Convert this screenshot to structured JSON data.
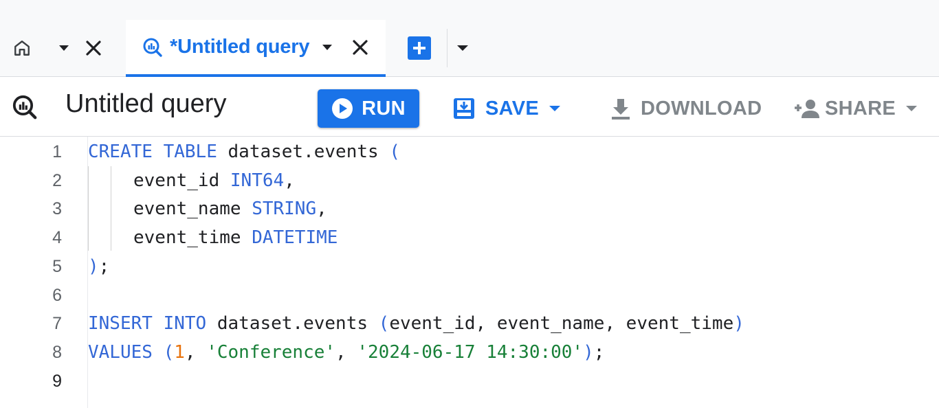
{
  "tabs": {
    "home": {
      "icon": "home-icon"
    },
    "query": {
      "label": "*Untitled query",
      "icon": "query-icon"
    }
  },
  "toolbar": {
    "title": "Untitled query",
    "run_label": "RUN",
    "save_label": "SAVE",
    "download_label": "DOWNLOAD",
    "share_label": "SHARE"
  },
  "editor": {
    "lines": [
      {
        "number": "1",
        "tokens": [
          {
            "t": "kw",
            "v": "CREATE"
          },
          {
            "t": "punc",
            "v": " "
          },
          {
            "t": "kw",
            "v": "TABLE"
          },
          {
            "t": "punc",
            "v": " dataset.events "
          },
          {
            "t": "paren",
            "v": "("
          }
        ]
      },
      {
        "number": "2",
        "indent": true,
        "tokens": [
          {
            "t": "punc",
            "v": "event_id "
          },
          {
            "t": "kw",
            "v": "INT64"
          },
          {
            "t": "punc",
            "v": ","
          }
        ]
      },
      {
        "number": "3",
        "indent": true,
        "tokens": [
          {
            "t": "punc",
            "v": "event_name "
          },
          {
            "t": "kw",
            "v": "STRING"
          },
          {
            "t": "punc",
            "v": ","
          }
        ]
      },
      {
        "number": "4",
        "indent": true,
        "tokens": [
          {
            "t": "punc",
            "v": "event_time "
          },
          {
            "t": "kw",
            "v": "DATETIME"
          }
        ]
      },
      {
        "number": "5",
        "tokens": [
          {
            "t": "paren",
            "v": ")"
          },
          {
            "t": "punc",
            "v": ";"
          }
        ]
      },
      {
        "number": "6",
        "tokens": []
      },
      {
        "number": "7",
        "tokens": [
          {
            "t": "kw",
            "v": "INSERT"
          },
          {
            "t": "punc",
            "v": " "
          },
          {
            "t": "kw",
            "v": "INTO"
          },
          {
            "t": "punc",
            "v": " dataset.events "
          },
          {
            "t": "paren",
            "v": "("
          },
          {
            "t": "punc",
            "v": "event_id, event_name, event_time"
          },
          {
            "t": "paren",
            "v": ")"
          }
        ]
      },
      {
        "number": "8",
        "tokens": [
          {
            "t": "kw",
            "v": "VALUES"
          },
          {
            "t": "punc",
            "v": " "
          },
          {
            "t": "paren",
            "v": "("
          },
          {
            "t": "num",
            "v": "1"
          },
          {
            "t": "punc",
            "v": ", "
          },
          {
            "t": "str",
            "v": "'Conference'"
          },
          {
            "t": "punc",
            "v": ", "
          },
          {
            "t": "str",
            "v": "'2024-06-17 14:30:00'"
          },
          {
            "t": "paren",
            "v": ")"
          },
          {
            "t": "punc",
            "v": ";"
          }
        ]
      },
      {
        "number": "9",
        "active": true,
        "tokens": []
      }
    ]
  },
  "colors": {
    "accent": "#1a73e8",
    "keyword": "#3367d6",
    "string": "#188038",
    "number": "#e8710a",
    "muted": "#80868b"
  }
}
